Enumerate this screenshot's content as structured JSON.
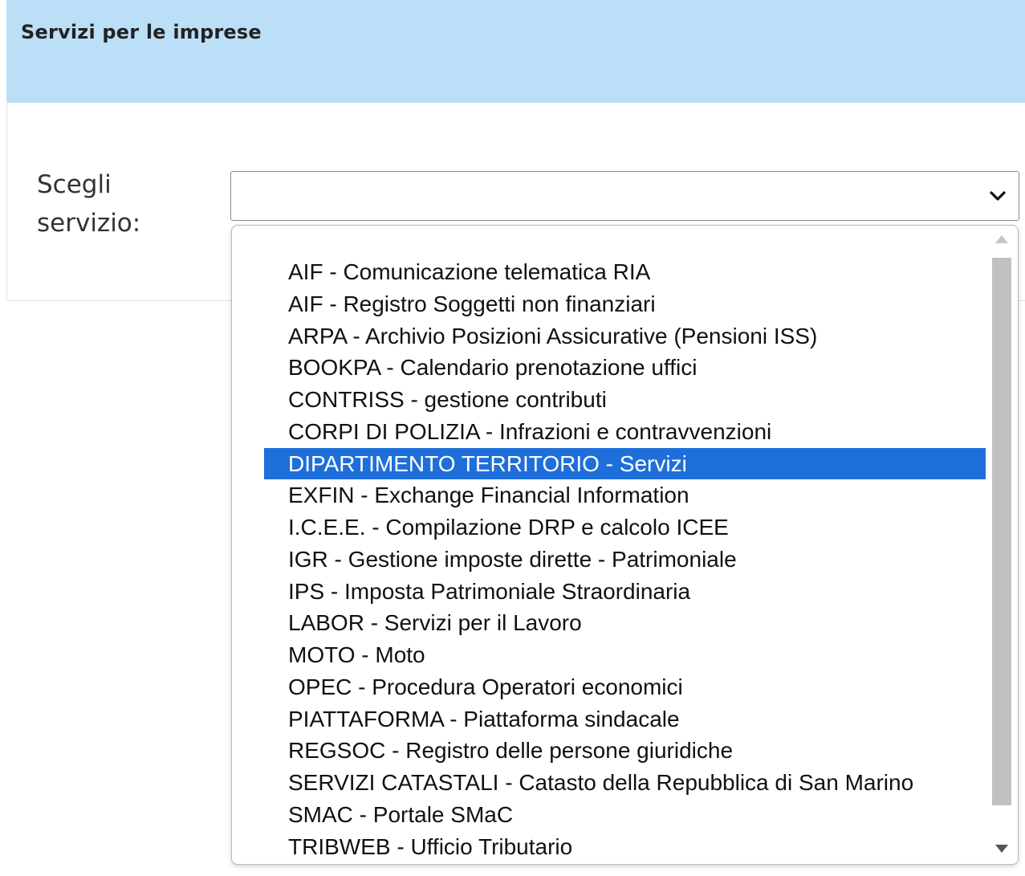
{
  "panel": {
    "title": "Servizi per le imprese",
    "field_label": "Scegli servizio:",
    "select_value": "",
    "accent_color": "#bcdff8",
    "selected_color": "#1e6fd9"
  },
  "dropdown": {
    "options": [
      "AIF - Comunicazione telematica RIA",
      "AIF - Registro Soggetti non finanziari",
      "ARPA - Archivio Posizioni Assicurative (Pensioni ISS)",
      "BOOKPA - Calendario prenotazione uffici",
      "CONTRISS - gestione contributi",
      "CORPI DI POLIZIA - Infrazioni e contravvenzioni",
      "DIPARTIMENTO TERRITORIO - Servizi",
      "EXFIN - Exchange Financial Information",
      "I.C.E.E. - Compilazione DRP e calcolo ICEE",
      "IGR - Gestione imposte dirette - Patrimoniale",
      "IPS - Imposta Patrimoniale Straordinaria",
      "LABOR - Servizi per il Lavoro",
      "MOTO - Moto",
      "OPEC - Procedura Operatori economici",
      "PIATTAFORMA - Piattaforma sindacale",
      "REGSOC - Registro delle persone giuridiche",
      "SERVIZI CATASTALI - Catasto della Repubblica di San Marino",
      "SMAC - Portale SMaC",
      "TRIBWEB - Ufficio Tributario"
    ],
    "highlighted_index": 6,
    "icons": {
      "select_arrow": "chevron-down-icon",
      "scroll_up": "scroll-up-arrow-icon",
      "scroll_down": "scroll-down-arrow-icon"
    }
  }
}
